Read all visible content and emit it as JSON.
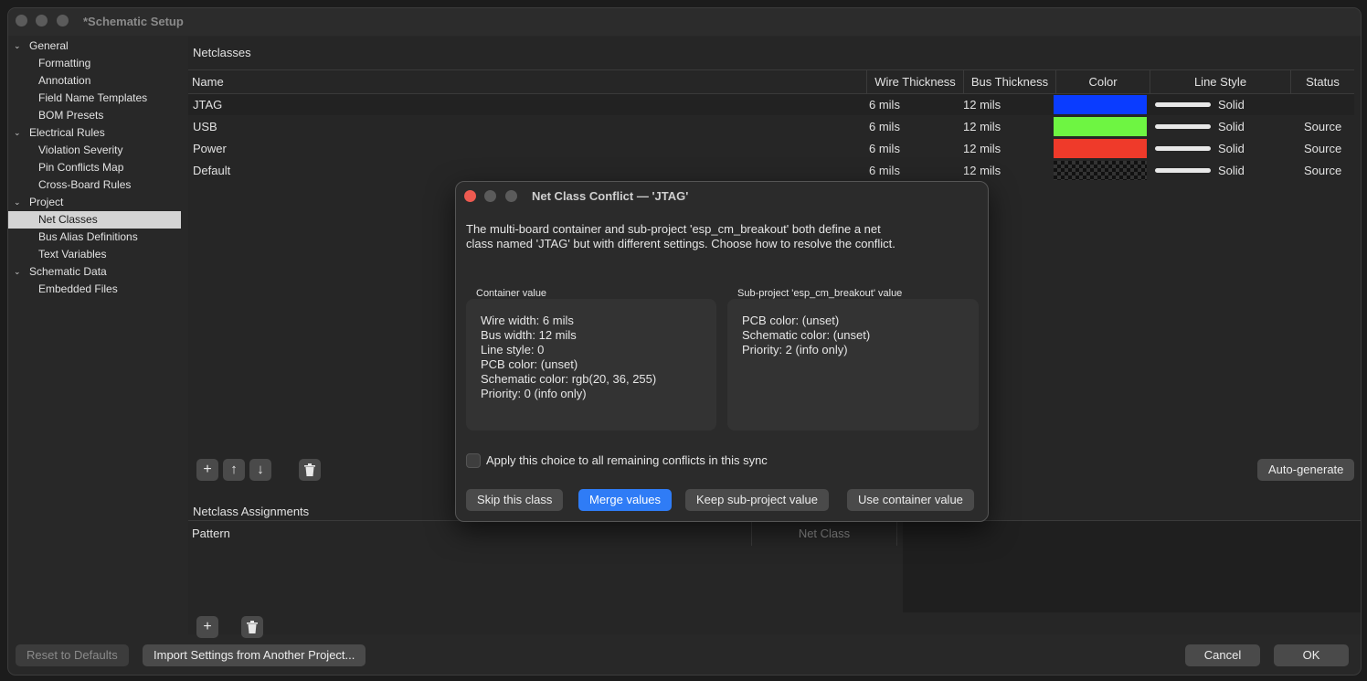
{
  "window": {
    "title": "*Schematic Setup"
  },
  "sidebar": {
    "groups": [
      {
        "label": "General",
        "items": [
          "Formatting",
          "Annotation",
          "Field Name Templates",
          "BOM Presets"
        ]
      },
      {
        "label": "Electrical Rules",
        "items": [
          "Violation Severity",
          "Pin Conflicts Map",
          "Cross-Board Rules"
        ]
      },
      {
        "label": "Project",
        "items": [
          "Net Classes",
          "Bus Alias Definitions",
          "Text Variables"
        ]
      },
      {
        "label": "Schematic Data",
        "items": [
          "Embedded Files"
        ]
      }
    ],
    "selected": "Net Classes"
  },
  "netclasses": {
    "title": "Netclasses",
    "columns": [
      "Name",
      "Wire Thickness",
      "Bus Thickness",
      "Color",
      "Line Style",
      "Status"
    ],
    "rows": [
      {
        "name": "JTAG",
        "wire": "6 mils",
        "bus": "12 mils",
        "color": "#0a3cff",
        "style": "Solid",
        "status": ""
      },
      {
        "name": "USB",
        "wire": "6 mils",
        "bus": "12 mils",
        "color": "#6ef542",
        "style": "Solid",
        "status": "Source"
      },
      {
        "name": "Power",
        "wire": "6 mils",
        "bus": "12 mils",
        "color": "#ef3a2a",
        "style": "Solid",
        "status": "Source"
      },
      {
        "name": "Default",
        "wire": "6 mils",
        "bus": "12 mils",
        "color": "checker",
        "style": "Solid",
        "status": "Source"
      }
    ],
    "auto_generate_label": "Auto-generate"
  },
  "assignments": {
    "title": "Netclass Assignments",
    "columns": [
      "Pattern",
      "Net Class"
    ]
  },
  "footer": {
    "reset_label": "Reset to Defaults",
    "import_label": "Import Settings from Another Project...",
    "cancel_label": "Cancel",
    "ok_label": "OK"
  },
  "dialog": {
    "title": "Net Class Conflict — 'JTAG'",
    "message": "The multi-board container and sub-project 'esp_cm_breakout' both define a net class named 'JTAG' but with different settings. Choose how to resolve the conflict.",
    "container_label": "Container value",
    "container_lines": [
      "Wire width: 6 mils",
      "Bus width: 12 mils",
      "Line style: 0",
      "PCB color: (unset)",
      "Schematic color: rgb(20, 36, 255)",
      "Priority: 0 (info only)"
    ],
    "subproject_label": "Sub-project 'esp_cm_breakout' value",
    "subproject_lines": [
      "PCB color: (unset)",
      "Schematic color: (unset)",
      "Priority: 2 (info only)"
    ],
    "apply_all_label": "Apply this choice to all remaining conflicts in this sync",
    "skip_label": "Skip this class",
    "merge_label": "Merge values",
    "keep_label": "Keep sub-project value",
    "use_container_label": "Use container value"
  },
  "colors": {
    "accent": "#2f7cf6",
    "close": "#ee5a50"
  }
}
